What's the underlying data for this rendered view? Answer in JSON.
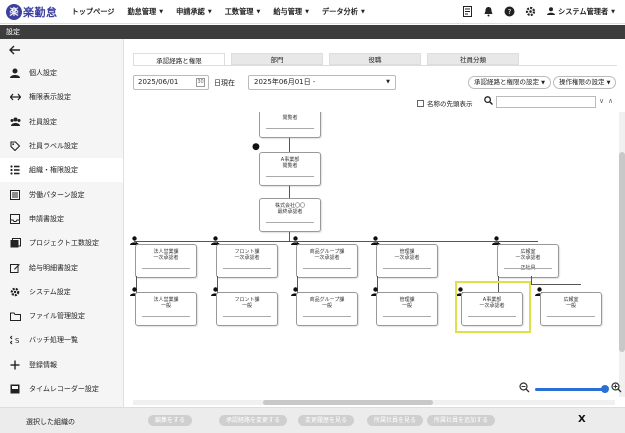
{
  "app": {
    "logo_glyph": "楽",
    "logo_text": "楽勤怠"
  },
  "nav": {
    "items": [
      {
        "label": "トップページ",
        "dropdown": false
      },
      {
        "label": "勤怠管理",
        "dropdown": true
      },
      {
        "label": "申請承認",
        "dropdown": true
      },
      {
        "label": "工数管理",
        "dropdown": true
      },
      {
        "label": "給与管理",
        "dropdown": true
      },
      {
        "label": "データ分析",
        "dropdown": true
      }
    ],
    "user": "システム管理者"
  },
  "page_title": "設定",
  "sidebar": {
    "items": [
      {
        "label": "個人設定",
        "icon": "person-icon"
      },
      {
        "label": "権限表示設定",
        "icon": "swap-arrows-icon"
      },
      {
        "label": "社員設定",
        "icon": "group-icon"
      },
      {
        "label": "社員ラベル設定",
        "icon": "tag-icon"
      },
      {
        "label": "組織・権限設定",
        "icon": "grid-dots-icon"
      },
      {
        "label": "労働パターン設定",
        "icon": "list-doc-icon"
      },
      {
        "label": "申請書設定",
        "icon": "inbox-icon"
      },
      {
        "label": "プロジェクト工数設定",
        "icon": "project-icon"
      },
      {
        "label": "給与明細書設定",
        "icon": "edit-icon"
      },
      {
        "label": "システム設定",
        "icon": "gear-icon"
      },
      {
        "label": "ファイル管理設定",
        "icon": "folder-icon"
      },
      {
        "label": "バッチ処理一覧",
        "icon": "batch-icon"
      },
      {
        "label": "登録情報",
        "icon": "plus-icon"
      },
      {
        "label": "タイムレコーダー設定",
        "icon": "recorder-icon"
      }
    ]
  },
  "tabs": [
    {
      "label": "承認経路と権限",
      "active": true
    },
    {
      "label": "部門",
      "active": false
    },
    {
      "label": "役職",
      "active": false
    },
    {
      "label": "社員分類",
      "active": false
    }
  ],
  "toolbar": {
    "date": "2025/06/01",
    "as_of": "日現在",
    "period_select": "2025年06月01日 -",
    "btn_route": "承認経路と権限の設定",
    "btn_ops": "操作権限の設定",
    "checkbox_label": "名称の先頭表示"
  },
  "chart": {
    "top_box": {
      "line1": "",
      "line2": "閲覧者"
    },
    "dept_box": {
      "line1": "A事業部",
      "line2": "閲覧者"
    },
    "company_box": {
      "line1": "株式会社〇〇",
      "line2": "最終承認者"
    },
    "row2": [
      {
        "line1": "法人営業課",
        "line2": "一次承認者"
      },
      {
        "line1": "フロント課",
        "line2": "一次承認者"
      },
      {
        "line1": "商品グループ課",
        "line2": "一次承認者"
      },
      {
        "line1": "管理課",
        "line2": "一次承認者"
      },
      {
        "line1": "広報室",
        "line2": "一次承認者",
        "tag": "正社員"
      }
    ],
    "row3": [
      {
        "line1": "法人営業課",
        "line2": "一般"
      },
      {
        "line1": "フロント課",
        "line2": "一般"
      },
      {
        "line1": "商品グループ課",
        "line2": "一般"
      },
      {
        "line1": "管理課",
        "line2": "一般"
      },
      {
        "line1": "A事業部",
        "line2": "一次承認者"
      },
      {
        "line1": "広報室",
        "line2": "一般"
      }
    ]
  },
  "zoom": {
    "level": 1.0
  },
  "footer": {
    "label": "選択した組織の",
    "buttons": [
      "編集をする",
      "承認経路を変更する",
      "変更履歴を見る",
      "所属社員を見る",
      "所属社員を追加する"
    ]
  }
}
